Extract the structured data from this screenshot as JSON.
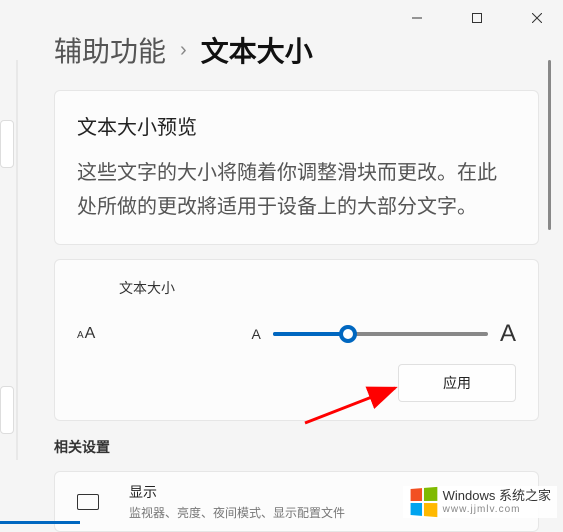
{
  "breadcrumb": {
    "parent": "辅助功能",
    "separator": "›",
    "current": "文本大小"
  },
  "preview": {
    "title": "文本大小预览",
    "body": "这些文字的大小将随着你调整滑块而更改。在此处所做的更改將适用于设备上的大部分文字。"
  },
  "slider": {
    "label": "文本大小",
    "min_glyph": "A",
    "max_glyph": "A",
    "value_percent": 35
  },
  "apply_label": "应用",
  "related": {
    "section_title": "相关设置",
    "display_title": "显示",
    "display_sub": "监视器、亮度、夜间模式、显示配置文件"
  },
  "watermark": {
    "title": "Windows 系统之家",
    "url": "www.jjmlv.com"
  }
}
